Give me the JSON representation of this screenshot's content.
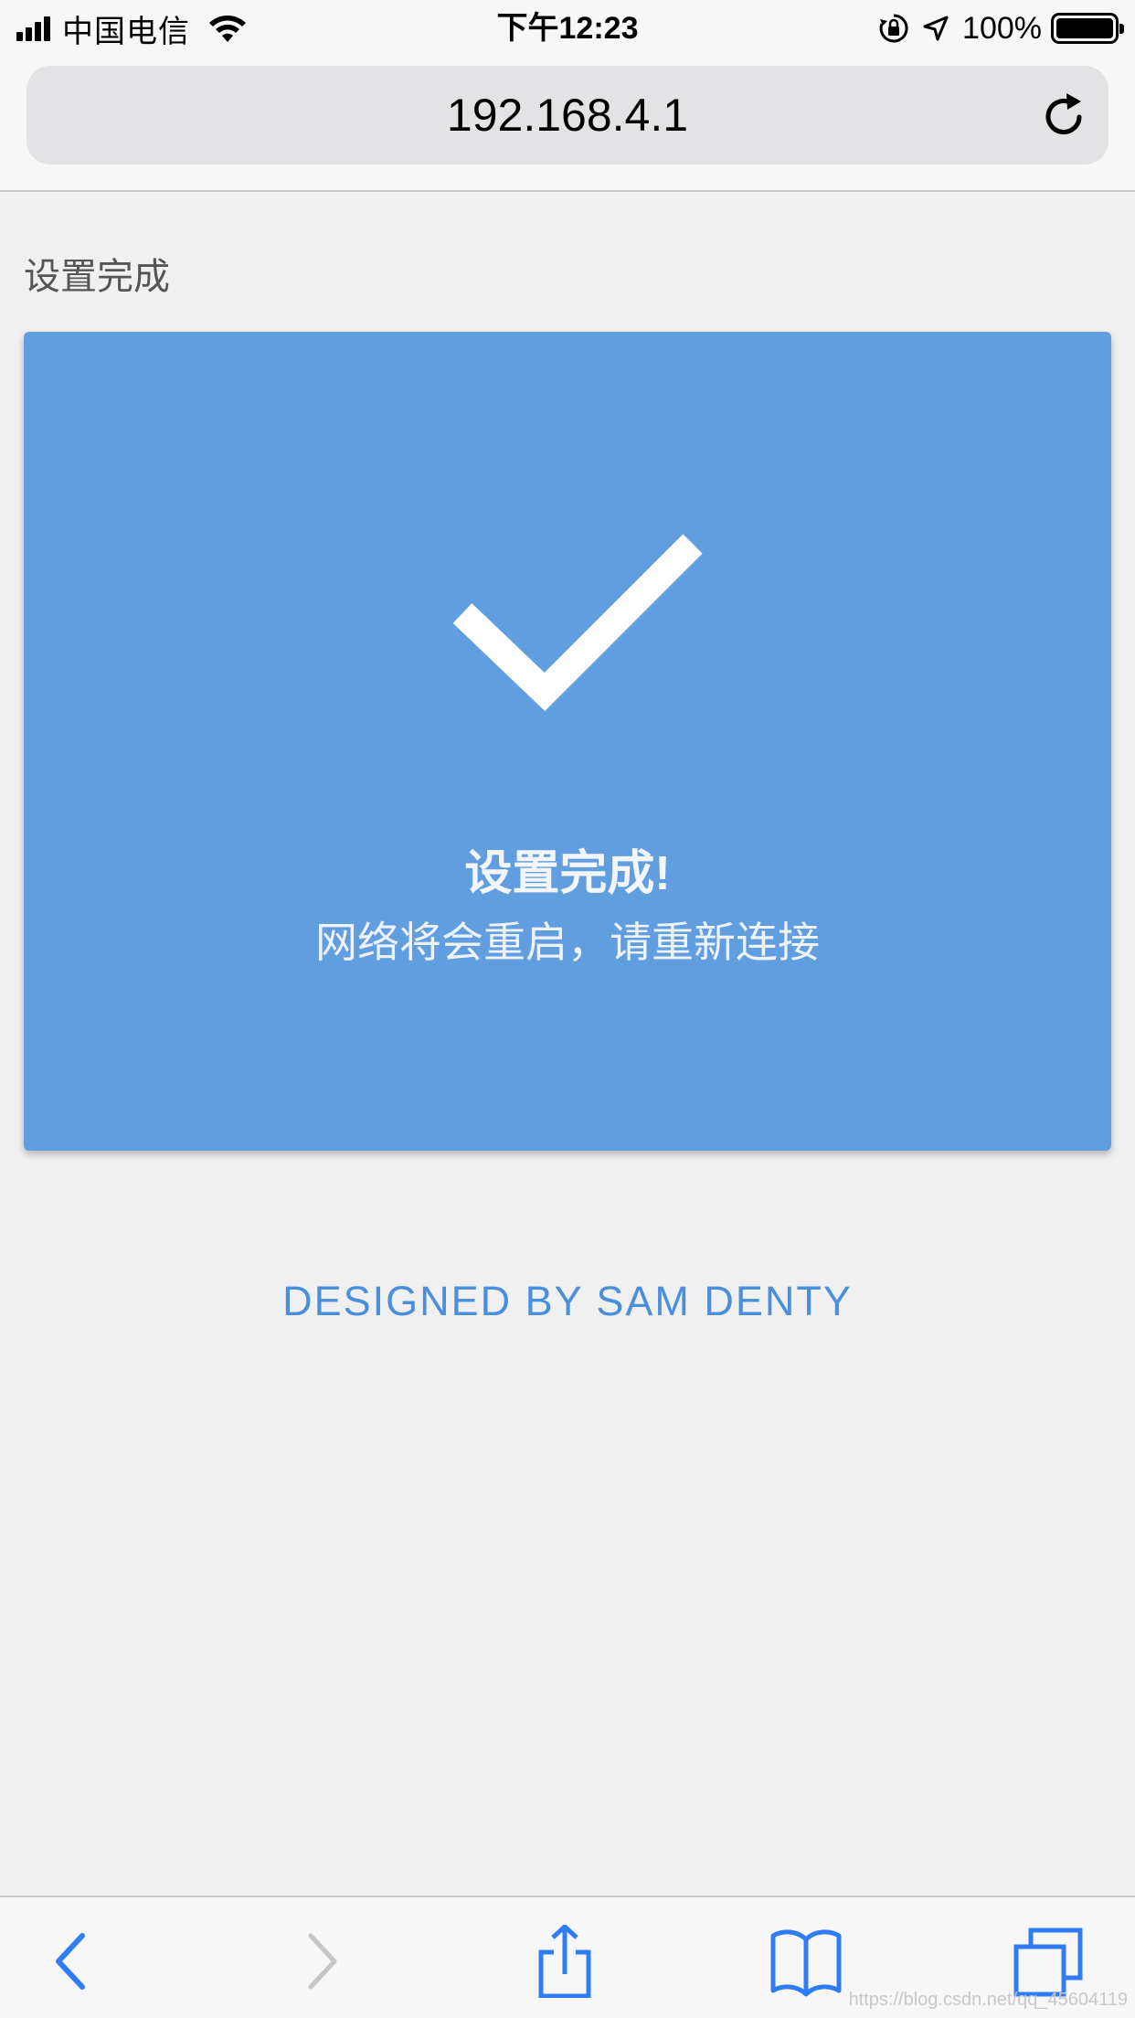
{
  "status_bar": {
    "carrier": "中国电信",
    "time": "下午12:23",
    "battery_percent": "100%",
    "icons": [
      "signal-icon",
      "wifi-icon",
      "orientation-lock-icon",
      "location-arrow-icon",
      "battery-icon"
    ]
  },
  "browser": {
    "url": "192.168.4.1",
    "reload_icon": "reload-icon"
  },
  "page": {
    "heading": "设置完成",
    "card": {
      "icon": "checkmark-icon",
      "title": "设置完成!",
      "subtitle": "网络将会重启，请重新连接",
      "background_color": "#619edf"
    },
    "credit": "DESIGNED BY SAM DENTY",
    "credit_color": "#4a8fdc"
  },
  "toolbar": {
    "items": [
      "back-icon",
      "forward-icon",
      "share-icon",
      "bookmarks-icon",
      "tabs-icon"
    ],
    "accent_color": "#2f7cf6"
  },
  "watermark": "https://blog.csdn.net/qq_45604119"
}
